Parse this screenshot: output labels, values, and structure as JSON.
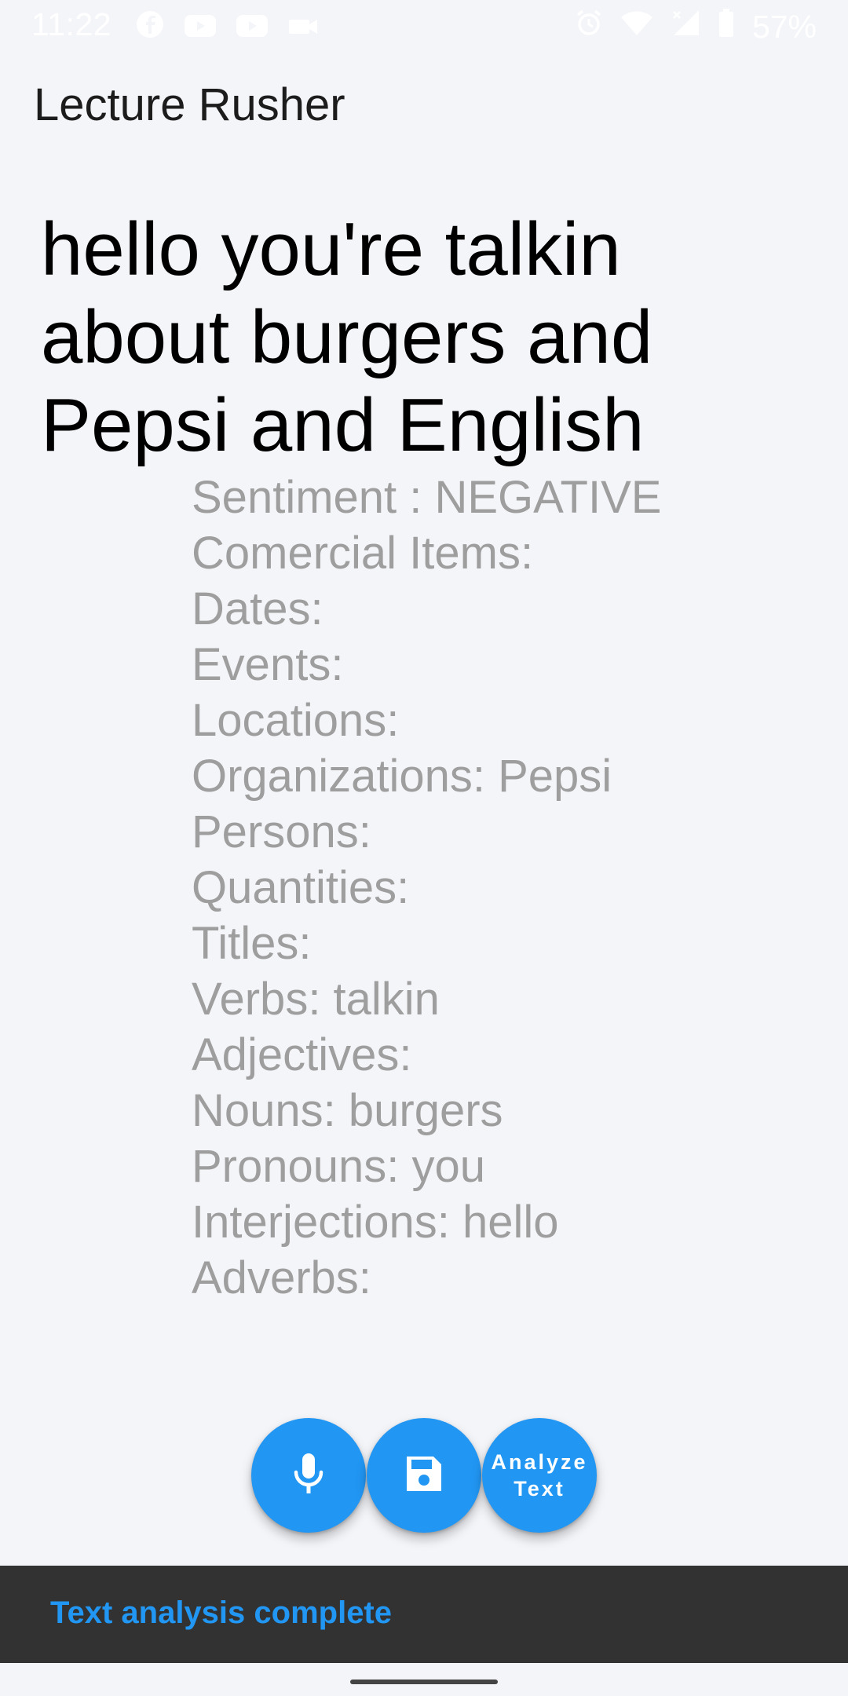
{
  "status_bar": {
    "time": "11:22",
    "battery": "57%",
    "left_icons": [
      "facebook-icon",
      "youtube-icon",
      "youtube-icon",
      "video-camera-icon"
    ],
    "right_icons": [
      "alarm-icon",
      "wifi-icon",
      "signal-icon",
      "battery-icon"
    ]
  },
  "app": {
    "title": "Lecture Rusher"
  },
  "transcript": {
    "text": "hello you're talkin about burgers and Pepsi and English"
  },
  "analysis": {
    "lines": [
      "Sentiment : NEGATIVE",
      "Comercial Items:",
      "Dates:",
      "Events:",
      "Locations:",
      "Organizations: Pepsi",
      "Persons:",
      "Quantities:",
      "Titles:",
      "Verbs: talkin",
      "Adjectives:",
      "Nouns: burgers",
      "Pronouns: you",
      "Interjections: hello",
      "Adverbs:"
    ]
  },
  "actions": {
    "mic_icon": "microphone-icon",
    "save_icon": "floppy-disk-icon",
    "analyze_label": "Analyze\nText"
  },
  "snackbar": {
    "message": "Text analysis complete"
  },
  "colors": {
    "accent": "#2196f3",
    "background": "#f4f5f9",
    "snackbar": "#323232",
    "analysis_text": "#9e9e9e"
  }
}
